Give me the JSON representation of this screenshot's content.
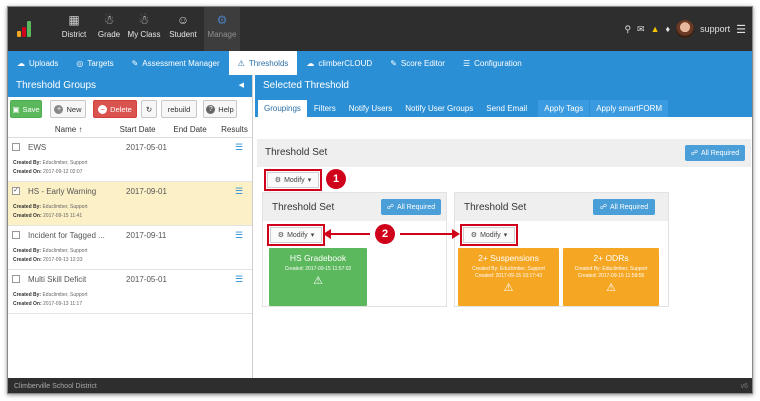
{
  "topbar": {
    "nav": [
      {
        "label": "District",
        "icon": "building-icon"
      },
      {
        "label": "Grade",
        "icon": "group-icon"
      },
      {
        "label": "My Class",
        "icon": "class-icon"
      },
      {
        "label": "Student",
        "icon": "user-icon"
      },
      {
        "label": "Manage",
        "icon": "gears-icon"
      }
    ],
    "user": "support"
  },
  "subnav": [
    {
      "label": "Uploads",
      "icon": "cloud-upload-icon"
    },
    {
      "label": "Targets",
      "icon": "target-icon"
    },
    {
      "label": "Assessment Manager",
      "icon": "pencil-icon"
    },
    {
      "label": "Thresholds",
      "icon": "warning-icon"
    },
    {
      "label": "climberCLOUD",
      "icon": "cloud-icon"
    },
    {
      "label": "Score Editor",
      "icon": "pencil-icon"
    },
    {
      "label": "Configuration",
      "icon": "menu-icon"
    }
  ],
  "left": {
    "title": "Threshold Groups",
    "buttons": {
      "save": "Save",
      "new": "New",
      "delete": "Delete",
      "rebuild": "rebuild",
      "help": "Help"
    },
    "columns": {
      "name": "Name",
      "start": "Start Date",
      "end": "End Date",
      "results": "Results"
    },
    "created_by_label": "Created By:",
    "created_on_label": "Created On:",
    "rows": [
      {
        "name": "EWS",
        "start": "2017-05-01",
        "by": "Educlimber, Support",
        "on": "2017-09-12 02:07",
        "checked": false
      },
      {
        "name": "HS - Early Warning",
        "start": "2017-09-01",
        "by": "Educlimber, Support",
        "on": "2017-09-15 11:41",
        "checked": true
      },
      {
        "name": "Incident for Tagged ...",
        "start": "2017-09-11",
        "by": "Educlimber, Support",
        "on": "2017-09-13 12:33",
        "checked": false
      },
      {
        "name": "Multi Skill Deficit",
        "start": "2017-05-01",
        "by": "Educlimber, Support",
        "on": "2017-09-13 11:17",
        "checked": false
      }
    ]
  },
  "right": {
    "title": "Selected Threshold",
    "tabs": [
      "Groupings",
      "Filters",
      "Notify Users",
      "Notify User Groups",
      "Send Email",
      "Apply Tags",
      "Apply smartFORM"
    ],
    "threshold_set_label": "Threshold Set",
    "all_required": "All Required",
    "modify": "Modify",
    "badges": [
      "1",
      "2"
    ],
    "cards": [
      {
        "title": "HS Gradebook",
        "by": "Created By: Educlimber, Support",
        "on": "Created: 2017-09-15 11:57:02",
        "color": "#5cb85c"
      },
      {
        "title": "2+ Suspensions",
        "by": "Created By: Educlimber, Support",
        "on": "Created: 2017-09-15 10:17:43",
        "color": "#f5a623"
      },
      {
        "title": "2+ ODRs",
        "by": "Created By: Educlimber, Support",
        "on": "Created: 2017-09-15 11:59:55",
        "color": "#f5a623"
      }
    ]
  },
  "footer": {
    "district": "Climberville School District",
    "version": "v6"
  },
  "colors": {
    "accent": "#2b8fd6",
    "annotation": "#d0021b"
  }
}
